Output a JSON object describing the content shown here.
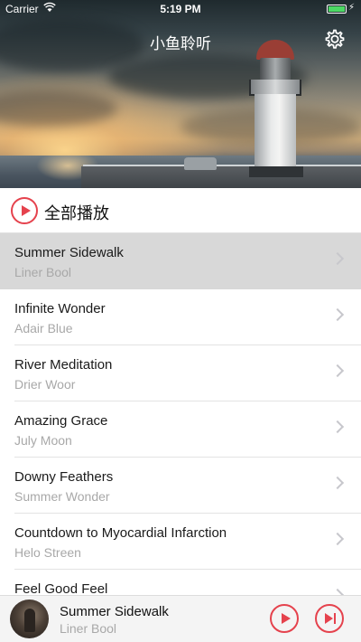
{
  "status_bar": {
    "carrier": "Carrier",
    "time": "5:19 PM"
  },
  "header": {
    "title": "小鱼聆听",
    "settings_icon": "gear-icon"
  },
  "play_all": {
    "label": "全部播放",
    "icon": "play-circle-icon"
  },
  "songs": [
    {
      "title": "Summer Sidewalk",
      "artist": "Liner Bool",
      "selected": true
    },
    {
      "title": "Infinite Wonder",
      "artist": "Adair Blue"
    },
    {
      "title": "River Meditation",
      "artist": "Drier Woor"
    },
    {
      "title": "Amazing Grace",
      "artist": "July Moon"
    },
    {
      "title": "Downy Feathers",
      "artist": "Summer Wonder"
    },
    {
      "title": "Countdown to Myocardial Infarction",
      "artist": "Helo Streen"
    },
    {
      "title": "Feel Good Feel",
      "artist": ""
    }
  ],
  "now_playing": {
    "title": "Summer Sidewalk",
    "artist": "Liner Bool"
  },
  "colors": {
    "accent": "#e5424d",
    "selected_row": "#d8d8d8"
  }
}
